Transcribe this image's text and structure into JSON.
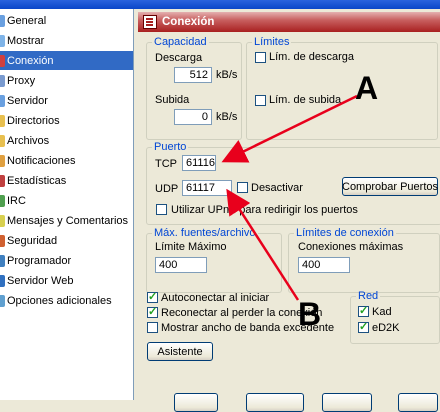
{
  "sidebar": {
    "items": [
      {
        "label": "General",
        "color": "#6aa0e0",
        "selected": false
      },
      {
        "label": "Mostrar",
        "color": "#7fb4e8",
        "selected": false
      },
      {
        "label": "Conexión",
        "color": "#d04040",
        "selected": true
      },
      {
        "label": "Proxy",
        "color": "#7a9bd0",
        "selected": false
      },
      {
        "label": "Servidor",
        "color": "#6aa0e0",
        "selected": false
      },
      {
        "label": "Directorios",
        "color": "#e8c050",
        "selected": false
      },
      {
        "label": "Archivos",
        "color": "#e8c050",
        "selected": false
      },
      {
        "label": "Notificaciones",
        "color": "#e0a040",
        "selected": false
      },
      {
        "label": "Estadísticas",
        "color": "#c04040",
        "selected": false
      },
      {
        "label": "IRC",
        "color": "#50a050",
        "selected": false
      },
      {
        "label": "Mensajes y Comentarios",
        "color": "#d8d050",
        "selected": false
      },
      {
        "label": "Seguridad",
        "color": "#d06030",
        "selected": false
      },
      {
        "label": "Programador",
        "color": "#4080c0",
        "selected": false
      },
      {
        "label": "Servidor Web",
        "color": "#3070c0",
        "selected": false
      },
      {
        "label": "Opciones adicionales",
        "color": "#60a0d0",
        "selected": false
      }
    ]
  },
  "panel": {
    "title": "Conexión"
  },
  "capacidad": {
    "legend": "Capacidad",
    "descarga_label": "Descarga",
    "descarga_value": "512",
    "descarga_unit": "kB/s",
    "subida_label": "Subida",
    "subida_value": "0",
    "subida_unit": "kB/s"
  },
  "limites": {
    "legend": "Límites",
    "lim_descarga": "Lím. de descarga",
    "lim_subida": "Lím. de subida"
  },
  "puerto": {
    "legend": "Puerto",
    "tcp_label": "TCP",
    "tcp_value": "61116",
    "udp_label": "UDP",
    "udp_value": "61117",
    "desactivar": "Desactivar",
    "comprobar_button": "Comprobar Puertos",
    "upnp": "Utilizar UPnP para redirigir los puertos"
  },
  "fuentes": {
    "legend": "Máx. fuentes/archivo",
    "limite_label": "Límite Máximo",
    "limite_value": "400"
  },
  "limites_conexion": {
    "legend": "Límites de conexión",
    "conexiones_label": "Conexiones máximas",
    "conexiones_value": "400"
  },
  "options": {
    "autoconectar": "Autoconectar al iniciar",
    "reconectar": "Reconectar al perder la conexión",
    "mostrar_ancho": "Mostrar ancho de banda excedente"
  },
  "red": {
    "legend": "Red",
    "kad": "Kad",
    "ed2k": "eD2K"
  },
  "asistente_button": "Asistente",
  "annotations": {
    "a": "A",
    "b": "B",
    "arrow_color": "#e8001c"
  }
}
